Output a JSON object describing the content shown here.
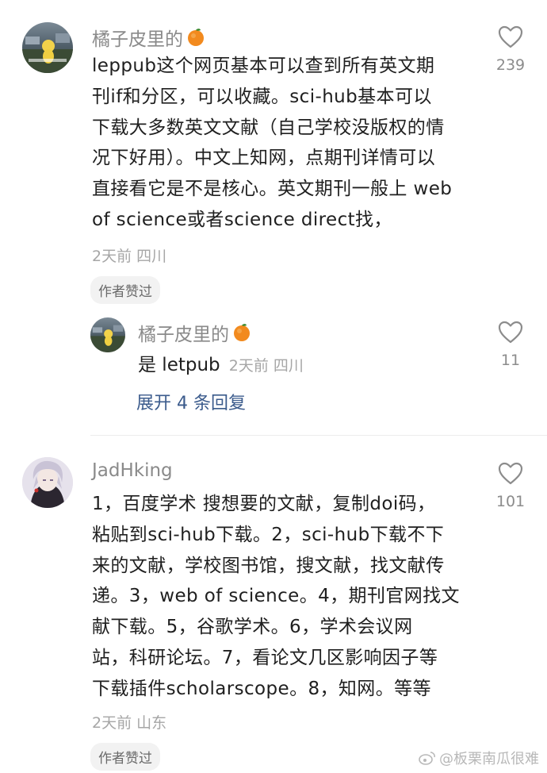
{
  "comments": [
    {
      "username": "橘子皮里的",
      "username_emoji": "orange-emoji",
      "body_lines": [
        "leppub这个网页基本可以查到所有英文期",
        "刊if和分区，可以收藏。sci-hub基本可以",
        "下载大多数英文文献（自己学校没版权的情",
        "况下好用）。中文上知网，点期刊详情可以",
        "直接看它是不是核心。英文期刊一般上 web",
        "of science或者science direct找，"
      ],
      "meta": "2天前 四川",
      "author_liked": "作者赞过",
      "likes": "239",
      "reply": {
        "username": "橘子皮里的",
        "text": "是 letpub",
        "meta": "2天前 四川",
        "likes": "11"
      },
      "expand_label": "展开 4 条回复"
    },
    {
      "username": "JadHking",
      "body_lines": [
        "1，百度学术 搜想要的文献，复制doi码，",
        "粘贴到sci-hub下载。2，sci-hub下载不下",
        "来的文献，学校图书馆，搜文献，找文献传",
        "递。3，web of science。4，期刊官网找文",
        "献下载。5，谷歌学术。6，学术会议网",
        "站，科研论坛。7，看论文几区影响因子等",
        "下载插件scholarscope。8，知网。等等"
      ],
      "meta": "2天前 山东",
      "author_liked": "作者赞过",
      "likes": "101"
    }
  ],
  "watermark": "@板栗南瓜很难",
  "colors": {
    "username": "#8a8a8a",
    "body": "#1f1f1f",
    "meta": "#a6a6a6",
    "link": "#3b5b8c",
    "pill_bg": "#f2f2f2"
  }
}
